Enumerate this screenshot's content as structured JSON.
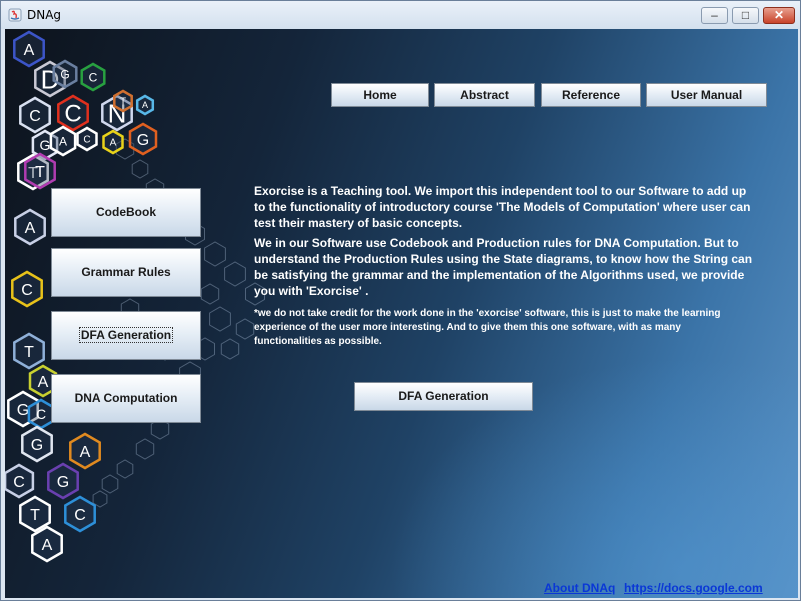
{
  "window": {
    "title": "DNAg",
    "controls": {
      "minimize": "–",
      "maximize": "□",
      "close": "✕"
    }
  },
  "nav": {
    "home": "Home",
    "abstract": "Abstract",
    "reference": "Reference",
    "user_manual": "User Manual"
  },
  "sidebar": {
    "codebook": "CodeBook",
    "grammar_rules": "Grammar Rules",
    "dfa_generation": "DFA Generation",
    "dna_computation": "DNA Computation"
  },
  "description": {
    "para1_lines": [
      "Exorcise is a Teaching tool. We import this independent tool to our Software to add up",
      "to the functionality of introductory course 'The Models of Computation' where user can",
      "test their mastery of basic concepts."
    ],
    "para2_lines": [
      "We in our Software use Codebook and Production rules for DNA Computation. But to",
      "understand the Production Rules using the State diagrams, to know how the String can",
      "be satisfying the grammar and the implementation of the Algorithms used, we provide",
      "you with 'Exorcise' ."
    ],
    "note_lines": [
      "*we do not take credit for the work done in the 'exorcise' software, this is just to make the learning",
      "experience of the user more interesting. And to give them this one software, with as many",
      "functionalities as possible."
    ]
  },
  "main_button": "DFA Generation",
  "logo_letters": [
    "D",
    "N",
    "A",
    "g"
  ],
  "hex_letters": [
    "A",
    "D",
    "C",
    "G",
    "T",
    "C",
    "N",
    "A",
    "T",
    "A",
    "C",
    "T",
    "A",
    "G",
    "C",
    "G",
    "A",
    "C",
    "G",
    "T",
    "C",
    "A",
    "G",
    "C",
    "C",
    "A",
    "G",
    "T",
    "A"
  ],
  "footer": {
    "about_link": "About DNAq",
    "docs_link": "https://docs.google.com"
  }
}
